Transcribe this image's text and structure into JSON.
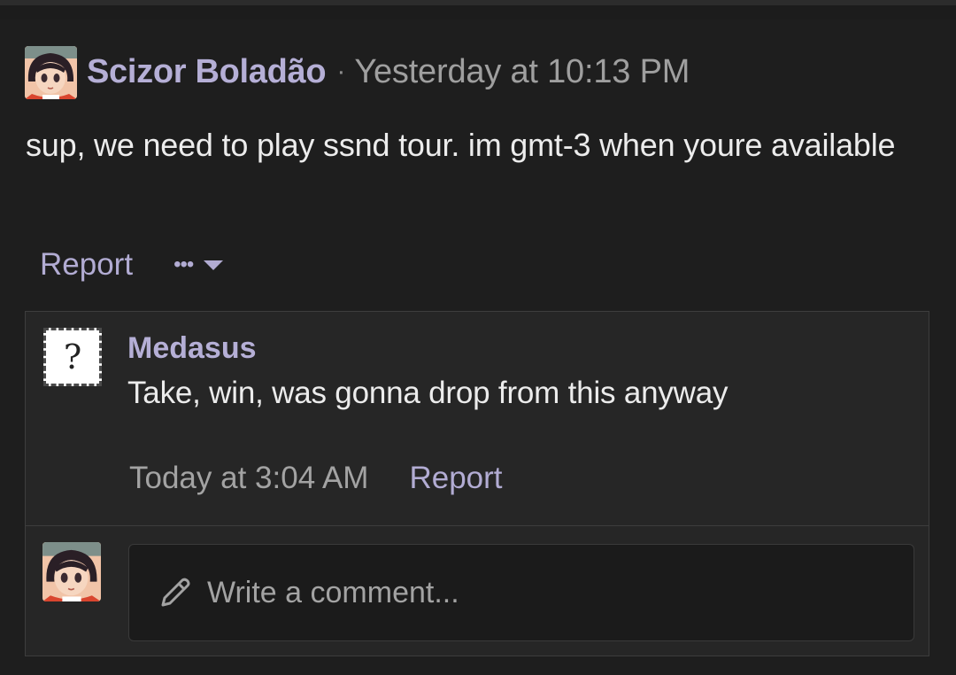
{
  "post": {
    "author": "Scizor Boladão",
    "separator": "·",
    "timestamp": "Yesterday at 10:13 PM",
    "message": "sup, we need to play ssnd tour. im gmt-3 when youre available",
    "report_label": "Report",
    "more_label": "•••"
  },
  "comment": {
    "author": "Medasus",
    "avatar_placeholder": "?",
    "text": "Take, win, was gonna drop from this anyway",
    "timestamp": "Today at 3:04 AM",
    "report_label": "Report"
  },
  "reply": {
    "placeholder": "Write a comment..."
  },
  "colors": {
    "background": "#1e1e1e",
    "panel": "#262626",
    "username": "#b5afd6",
    "link": "#b2acd3",
    "muted": "#9f9f9f"
  },
  "icons": {
    "more": "ellipsis-icon",
    "caret": "caret-down-icon",
    "compose": "pencil-icon"
  }
}
